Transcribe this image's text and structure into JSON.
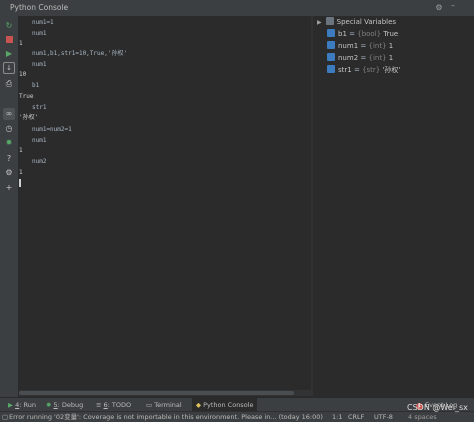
{
  "window": {
    "title": "Python Console"
  },
  "toolbar_icons": [
    "rerun-icon",
    "stop-icon",
    "run-icon",
    "new-console-icon",
    "print-icon",
    "glasses-icon",
    "history-icon",
    "debug-icon",
    "help-icon",
    "settings-icon",
    "add-icon"
  ],
  "console": {
    "lines": [
      {
        "kind": "in",
        "text": "num1=1"
      },
      {
        "kind": "in",
        "text": "num1"
      },
      {
        "kind": "out",
        "text": "1"
      },
      {
        "kind": "in",
        "text": "num1,b1,str1=10,True,'孙权'"
      },
      {
        "kind": "in",
        "text": "num1"
      },
      {
        "kind": "out",
        "text": "10"
      },
      {
        "kind": "in",
        "text": "b1"
      },
      {
        "kind": "out",
        "text": "True"
      },
      {
        "kind": "in",
        "text": "str1"
      },
      {
        "kind": "out",
        "text": "'孙权'"
      },
      {
        "kind": "in",
        "text": "num1=num2=1"
      },
      {
        "kind": "in",
        "text": "num1"
      },
      {
        "kind": "out",
        "text": "1"
      },
      {
        "kind": "in",
        "text": "num2"
      },
      {
        "kind": "out",
        "text": "1"
      }
    ]
  },
  "variables": {
    "header": "Special Variables",
    "items": [
      {
        "name": "b1",
        "type": "{bool}",
        "value": "True"
      },
      {
        "name": "num1",
        "type": "{int}",
        "value": "1"
      },
      {
        "name": "num2",
        "type": "{int}",
        "value": "1"
      },
      {
        "name": "str1",
        "type": "{str}",
        "value": "'孙权'"
      }
    ]
  },
  "bottom_tabs": {
    "run": {
      "num": "4",
      "label": ": Run"
    },
    "debug": {
      "num": "5",
      "label": ": Debug"
    },
    "todo": {
      "num": "6",
      "label": ": TODO"
    },
    "terminal": {
      "label": "Terminal"
    },
    "python_console": {
      "label": "Python Console"
    },
    "event_log": {
      "badge": "1",
      "label": "Event Log"
    }
  },
  "status": {
    "message": "Error running '02变量': Coverage is not importable in this environment. Please in... (today 16:00)",
    "position": "1:1",
    "line_sep": "CRLF",
    "encoding": "UTF-8",
    "indent": "4 spaces"
  },
  "watermark": "CSDN @Wei_sx"
}
